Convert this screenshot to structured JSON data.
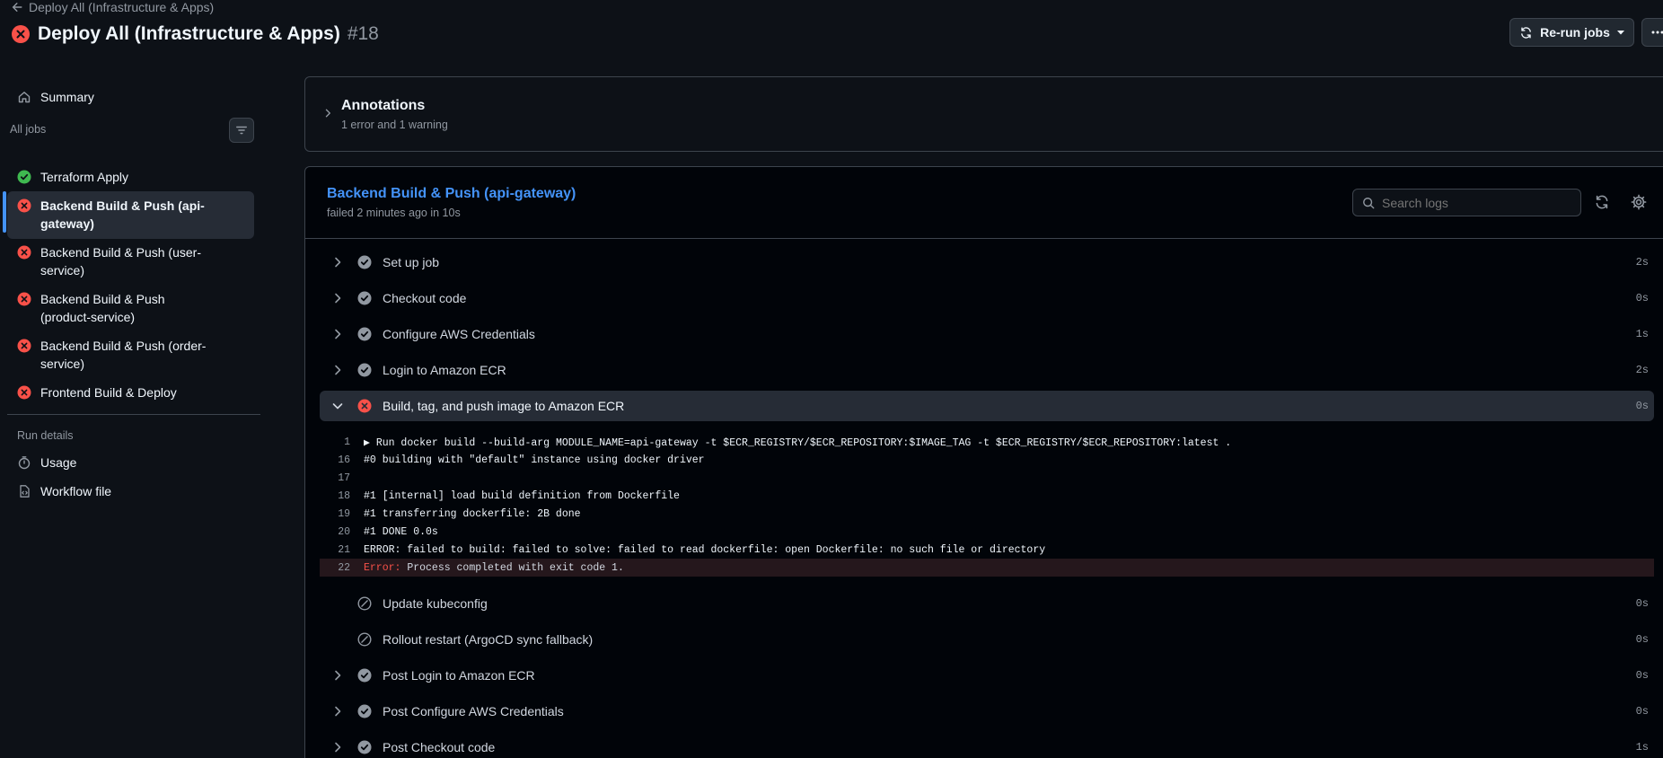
{
  "header": {
    "back_label": "Deploy All (Infrastructure & Apps)",
    "title": "Deploy All (Infrastructure & Apps)",
    "run_number": "#18",
    "rerun_label": "Re-run jobs"
  },
  "sidebar": {
    "summary_label": "Summary",
    "all_jobs_label": "All jobs",
    "jobs": [
      {
        "label": "Terraform Apply",
        "status": "success"
      },
      {
        "label": "Backend Build & Push (api-gateway)",
        "status": "failure",
        "active": true
      },
      {
        "label": "Backend Build & Push (user-service)",
        "status": "failure"
      },
      {
        "label": "Backend Build & Push (product-service)",
        "status": "failure"
      },
      {
        "label": "Backend Build & Push (order-service)",
        "status": "failure"
      },
      {
        "label": "Frontend Build & Deploy",
        "status": "failure"
      }
    ],
    "run_details_label": "Run details",
    "usage_label": "Usage",
    "workflow_file_label": "Workflow file"
  },
  "annotations": {
    "title": "Annotations",
    "summary": "1 error and 1 warning"
  },
  "job": {
    "title": "Backend Build & Push (api-gateway)",
    "meta": "failed 2 minutes ago in 10s",
    "search_placeholder": "Search logs"
  },
  "steps_before": [
    {
      "name": "Set up job",
      "duration": "2s"
    },
    {
      "name": "Checkout code",
      "duration": "0s"
    },
    {
      "name": "Configure AWS Credentials",
      "duration": "1s"
    },
    {
      "name": "Login to Amazon ECR",
      "duration": "2s"
    }
  ],
  "open_step": {
    "name": "Build, tag, and push image to Amazon ECR",
    "duration": "0s"
  },
  "log_lines": [
    {
      "n": "1",
      "text": "▶ Run docker build --build-arg MODULE_NAME=api-gateway -t $ECR_REGISTRY/$ECR_REPOSITORY:$IMAGE_TAG -t $ECR_REGISTRY/$ECR_REPOSITORY:latest ."
    },
    {
      "n": "16",
      "text": "#0 building with \"default\" instance using docker driver"
    },
    {
      "n": "17",
      "text": ""
    },
    {
      "n": "18",
      "text": "#1 [internal] load build definition from Dockerfile"
    },
    {
      "n": "19",
      "text": "#1 transferring dockerfile: 2B done"
    },
    {
      "n": "20",
      "text": "#1 DONE 0.0s"
    },
    {
      "n": "21",
      "text": "ERROR: failed to build: failed to solve: failed to read dockerfile: open Dockerfile: no such file or directory"
    }
  ],
  "error_line": {
    "n": "22",
    "keyword": "Error:",
    "text": " Process completed with exit code 1."
  },
  "steps_after": [
    {
      "name": "Update kubeconfig",
      "duration": "0s",
      "status": "skipped"
    },
    {
      "name": "Rollout restart (ArgoCD sync fallback)",
      "duration": "0s",
      "status": "skipped"
    },
    {
      "name": "Post Login to Amazon ECR",
      "duration": "0s",
      "status": "success"
    },
    {
      "name": "Post Configure AWS Credentials",
      "duration": "0s",
      "status": "success"
    },
    {
      "name": "Post Checkout code",
      "duration": "1s",
      "status": "success"
    }
  ],
  "colors": {
    "background": "#0d1117",
    "success": "#3fb950",
    "failure": "#f85149",
    "accent": "#4493f8",
    "muted": "#9198a1"
  },
  "icons": [
    "arrow-left-icon",
    "x-circle-fill-icon",
    "sync-icon",
    "triangle-down-icon",
    "kebab-horizontal-icon",
    "home-icon",
    "filter-icon",
    "check-circle-fill-icon",
    "stopwatch-icon",
    "file-code-icon",
    "chevron-right-icon",
    "chevron-down-icon",
    "search-icon",
    "gear-icon",
    "skip-icon"
  ]
}
